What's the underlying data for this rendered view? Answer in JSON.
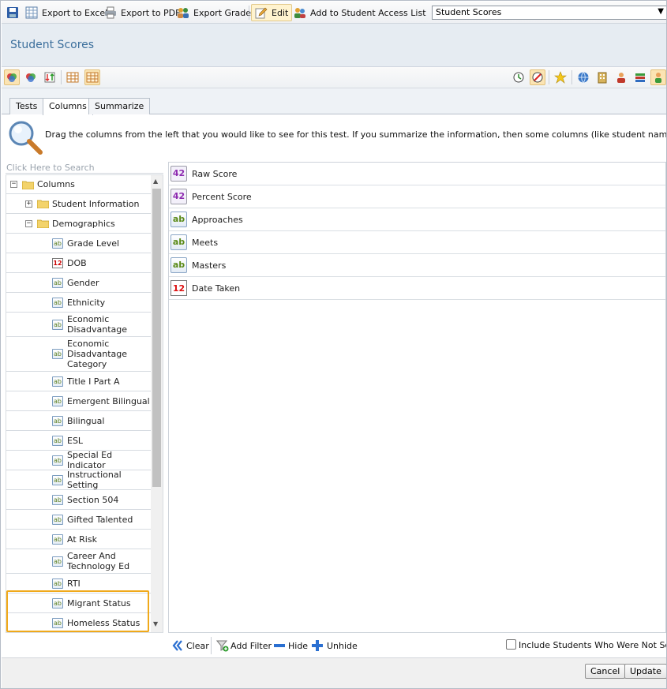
{
  "toolbar": {
    "export_excel": "Export to Excel",
    "export_pdf": "Export to PDF",
    "export_grades": "Export Grades",
    "edit": "Edit",
    "add_access": "Add to Student Access List",
    "report_select": "Student Scores"
  },
  "header": {
    "title": "Student Scores"
  },
  "tabs": [
    "Tests",
    "Columns",
    "Summarize"
  ],
  "help_text": "Drag the columns from the left that you would like to see for this test. If you summarize the information, then some columns (like student name) should not be used.",
  "search": {
    "placeholder": "Click Here to Search"
  },
  "tree": {
    "root": "Columns",
    "student_information": "Student Information",
    "demographics": "Demographics",
    "fields": [
      "Grade Level",
      "DOB",
      "Gender",
      "Ethnicity",
      "Economic Disadvantage",
      "Economic Disadvantage Category",
      "Title I Part A",
      "Emergent Bilingual",
      "Bilingual",
      "ESL",
      "Special Ed Indicator",
      "Instructional Setting",
      "Section 504",
      "Gifted Talented",
      "At Risk",
      "Career And Technology Ed",
      "RTI",
      "Migrant Status",
      "Homeless Status"
    ]
  },
  "selected_columns": [
    {
      "label": "Raw Score",
      "icon": "number-icon",
      "glyph": "42"
    },
    {
      "label": "Percent Score",
      "icon": "number-icon",
      "glyph": "42"
    },
    {
      "label": "Approaches",
      "icon": "text-icon",
      "glyph": "ab"
    },
    {
      "label": "Meets",
      "icon": "text-icon",
      "glyph": "ab"
    },
    {
      "label": "Masters",
      "icon": "text-icon",
      "glyph": "ab"
    },
    {
      "label": "Date Taken",
      "icon": "calendar-icon",
      "glyph": "12"
    }
  ],
  "actions": {
    "clear": "Clear",
    "add_filter": "Add Filter",
    "hide": "Hide",
    "unhide": "Unhide"
  },
  "include_unscored": "Include Students Who Were Not Scored",
  "footer": {
    "cancel": "Cancel",
    "update": "Update"
  },
  "colors": {
    "highlight": "#f0a91a",
    "title": "#3c6f9c",
    "accent_blue": "#2a6fd1"
  }
}
